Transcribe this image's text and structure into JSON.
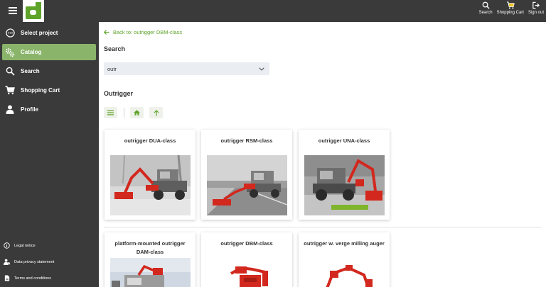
{
  "topbar": {
    "actions": [
      {
        "label": "Search",
        "icon": "search-icon"
      },
      {
        "label": "Shopping Cart",
        "icon": "cart-icon"
      },
      {
        "label": "Sign out",
        "icon": "sign-out-icon"
      }
    ]
  },
  "sidebar": {
    "items": [
      {
        "label": "Select project",
        "icon": "ellipsis-circle-icon"
      },
      {
        "label": "Catalog",
        "icon": "gears-icon",
        "active": true
      },
      {
        "label": "Search",
        "icon": "search-icon"
      },
      {
        "label": "Shopping Cart",
        "icon": "cart-icon"
      },
      {
        "label": "Profile",
        "icon": "user-icon"
      }
    ],
    "footer": [
      {
        "label": "Legal notice",
        "icon": "info-icon"
      },
      {
        "label": "Data privacy statement",
        "icon": "user-shield-icon"
      },
      {
        "label": "Terms and conditions",
        "icon": "document-icon"
      }
    ]
  },
  "main": {
    "back_link": "Back to: outrigger DBM-class",
    "search_heading": "Search",
    "search_value": "outr",
    "category_heading": "Outrigger",
    "toolbar": [
      "list-icon",
      "home-icon",
      "arrow-up-icon"
    ],
    "cards": [
      {
        "title": "outrigger DUA-class"
      },
      {
        "title": "outrigger RSM-class"
      },
      {
        "title": "outrigger UNA-class"
      },
      {
        "title": "platform-mounted outrigger DAM-class"
      },
      {
        "title": "outrigger DBM-class"
      },
      {
        "title": "outrigger w. verge milling auger"
      }
    ]
  },
  "colors": {
    "accent": "#5fa32b",
    "active_nav": "#8ab46a",
    "chrome": "#3a3a3a",
    "machine_red": "#d2281e"
  }
}
